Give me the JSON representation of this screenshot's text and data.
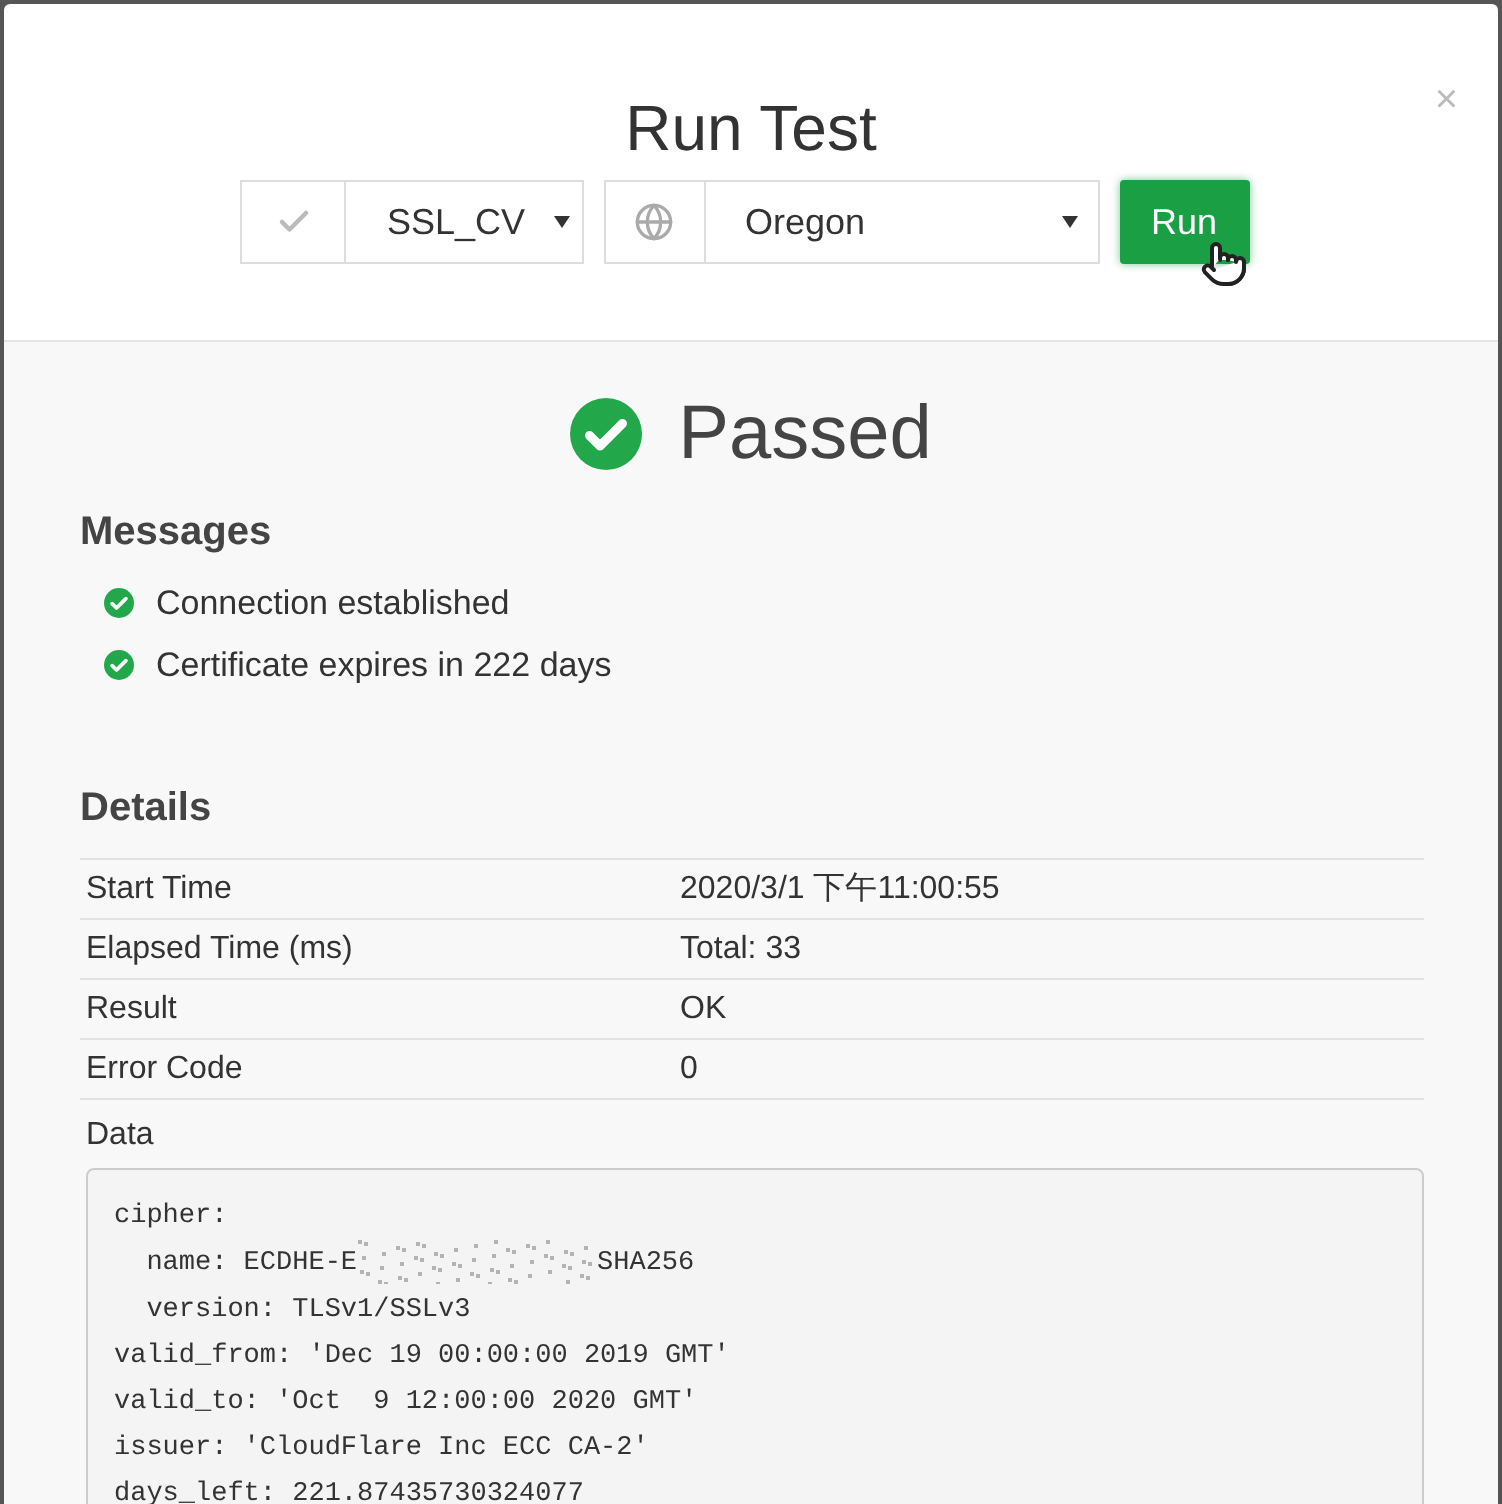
{
  "dialog": {
    "title": "Run Test",
    "close": "×"
  },
  "controls": {
    "test": {
      "value": "SSL_CV"
    },
    "location": {
      "value": "Oregon"
    },
    "run_button": "Run"
  },
  "status": {
    "kind": "passed",
    "label": "Passed"
  },
  "messages": {
    "heading": "Messages",
    "items": [
      {
        "text": "Connection established"
      },
      {
        "text": "Certificate expires in 222 days"
      }
    ]
  },
  "details": {
    "heading": "Details",
    "rows": [
      {
        "label": "Start Time",
        "value": "2020/3/1 下午11:00:55"
      },
      {
        "label": "Elapsed Time (ms)",
        "value": "Total: 33"
      },
      {
        "label": "Result",
        "value": "OK"
      },
      {
        "label": "Error Code",
        "value": "0"
      }
    ],
    "data_label": "Data",
    "data_lines": [
      {
        "kind": "text",
        "text": "cipher:"
      },
      {
        "kind": "redacted",
        "before": "  name: ECDHE-E",
        "after": "SHA256"
      },
      {
        "kind": "text",
        "text": "  version: TLSv1/SSLv3"
      },
      {
        "kind": "text",
        "text": "valid_from: 'Dec 19 00:00:00 2019 GMT'"
      },
      {
        "kind": "text",
        "text": "valid_to: 'Oct  9 12:00:00 2020 GMT'"
      },
      {
        "kind": "text",
        "text": "issuer: 'CloudFlare Inc ECC CA-2'"
      },
      {
        "kind": "text",
        "text": "days_left: 221.87435730324077"
      }
    ]
  }
}
